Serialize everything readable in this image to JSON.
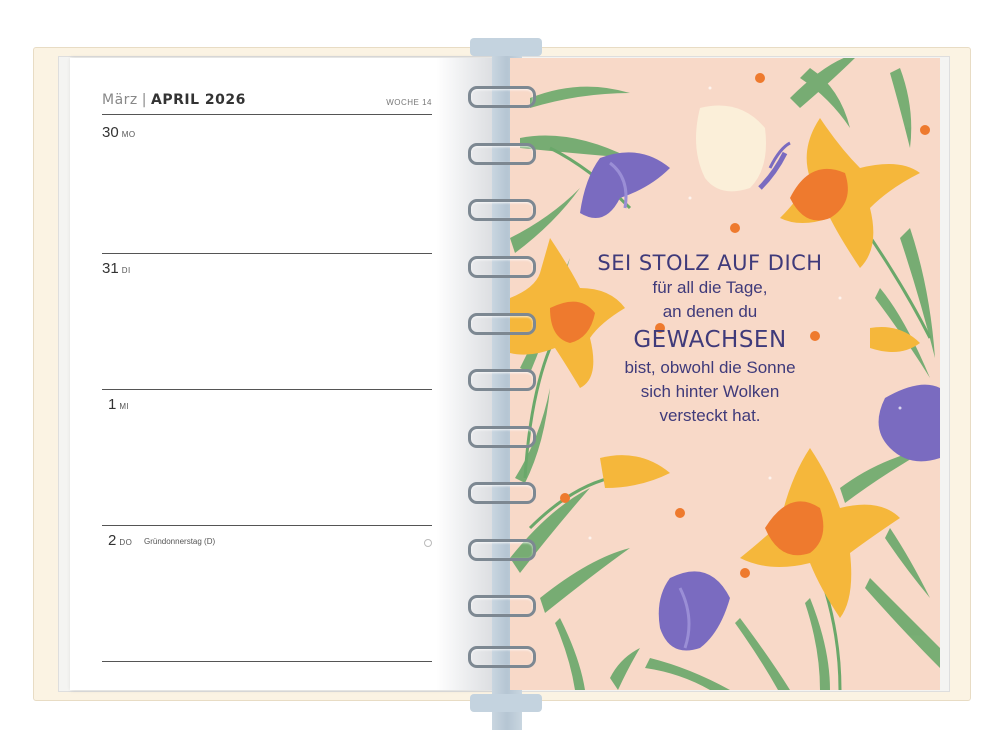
{
  "left_page": {
    "header": {
      "month_prev": "März",
      "separator": "|",
      "month_current": "APRIL 2026",
      "week": "WOCHE 14"
    },
    "days": [
      {
        "num": "30",
        "name": "MO",
        "holiday": ""
      },
      {
        "num": "31",
        "name": "DI",
        "holiday": ""
      },
      {
        "num": "1",
        "name": "MI",
        "holiday": ""
      },
      {
        "num": "2",
        "name": "DO",
        "holiday": "Gründonnerstag (D)"
      }
    ]
  },
  "right_page": {
    "quote": {
      "line1": "SEI STOLZ AUF DICH",
      "line2": "für all die Tage,",
      "line3": "an denen du",
      "line4": "GEWACHSEN",
      "line5": "bist, obwohl die Sonne",
      "line6": "sich hinter Wolken",
      "line7": "versteckt hat."
    },
    "colors": {
      "background": "#f8d9c8",
      "text": "#3f3a7a",
      "crocus": "#7a6bc0",
      "daffodil": "#f5b73b",
      "trumpet": "#ee7a2e",
      "leaf": "#6aa86a"
    }
  }
}
